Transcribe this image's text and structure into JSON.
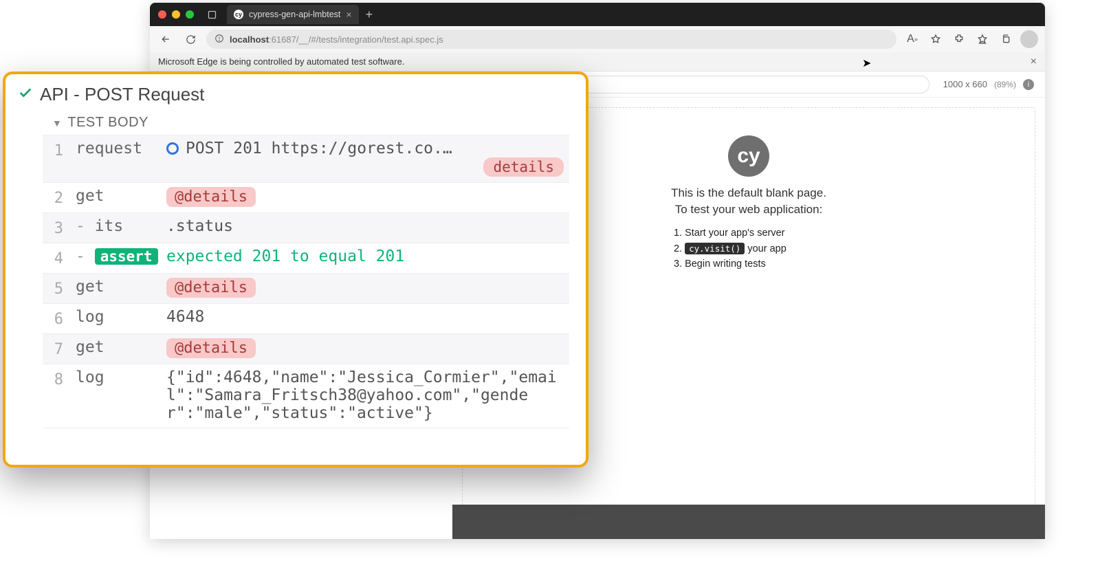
{
  "browser": {
    "tab_title": "cypress-gen-api-lmbtest",
    "url_prefix": "localhost",
    "url_rest": ":61687/__/#/tests/integration/test.api.spec.js",
    "banner_text": "Microsoft Edge is being controlled by automated test software."
  },
  "viewport": {
    "dimensions": "1000 x 660",
    "percent": "(89%)"
  },
  "aut": {
    "line1": "This is the default blank page.",
    "line2": "To test your web application:",
    "steps": {
      "s1": "Start your app's server",
      "s2_code": "cy.visit()",
      "s2_rest": " your app",
      "s3": "Begin writing tests"
    }
  },
  "test": {
    "title": "API - POST Request",
    "section": "TEST BODY",
    "rows": [
      {
        "n": "1",
        "cmd": "request",
        "kind": "request",
        "method": "POST",
        "status": "201",
        "url": "https://gorest.co.…",
        "pill": "details"
      },
      {
        "n": "2",
        "cmd": "get",
        "kind": "alias",
        "value": "@details"
      },
      {
        "n": "3",
        "cmd": "its",
        "kind": "plain",
        "value": ".status",
        "nested": true
      },
      {
        "n": "4",
        "cmd": "assert",
        "kind": "assert",
        "value": "expected  201  to equal  201",
        "nested": true
      },
      {
        "n": "5",
        "cmd": "get",
        "kind": "alias",
        "value": "@details"
      },
      {
        "n": "6",
        "cmd": "log",
        "kind": "plain",
        "value": "4648"
      },
      {
        "n": "7",
        "cmd": "get",
        "kind": "alias",
        "value": "@details"
      },
      {
        "n": "8",
        "cmd": "log",
        "kind": "plain",
        "value": "{\"id\":4648,\"name\":\"Jessica_Cormier\",\"email\":\"Samara_Fritsch38@yahoo.com\",\"gender\":\"male\",\"status\":\"active\"}"
      }
    ]
  }
}
